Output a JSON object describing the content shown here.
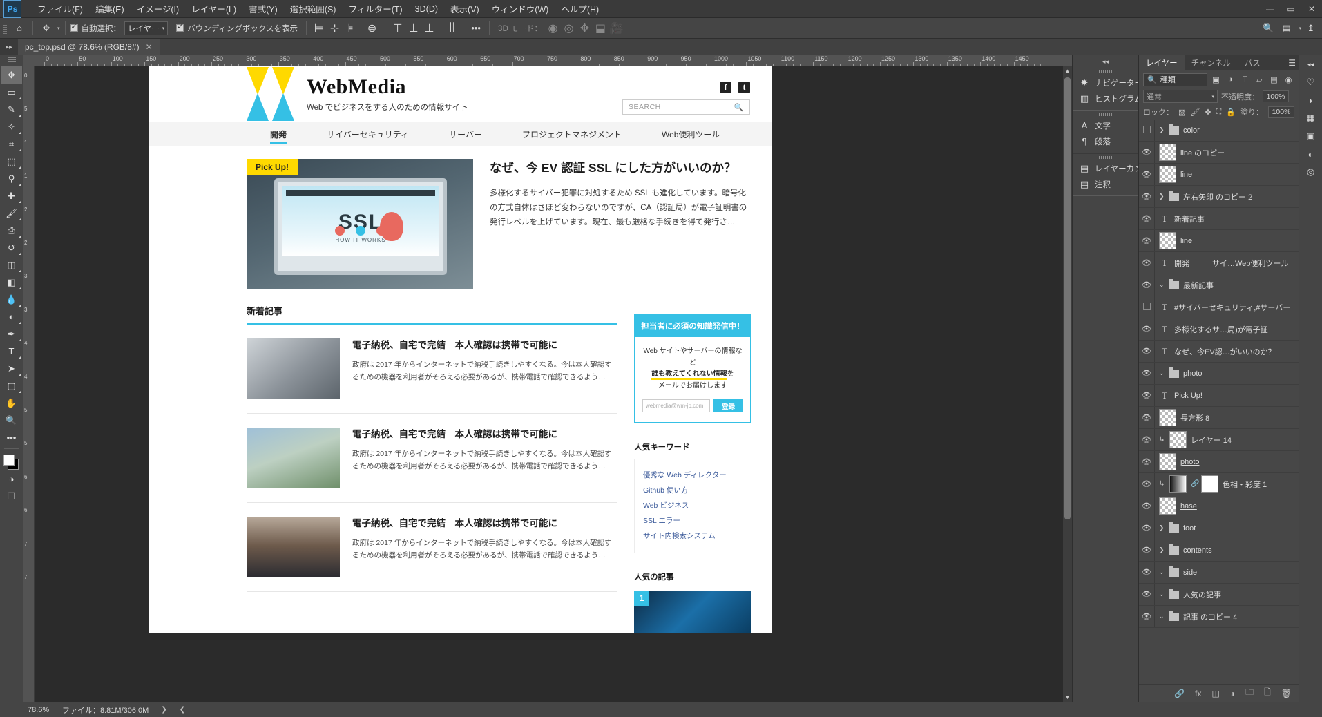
{
  "app": {
    "logo": "Ps",
    "menus": [
      {
        "label": "ファイル(F)"
      },
      {
        "label": "編集(E)"
      },
      {
        "label": "イメージ(I)"
      },
      {
        "label": "レイヤー(L)"
      },
      {
        "label": "書式(Y)"
      },
      {
        "label": "選択範囲(S)"
      },
      {
        "label": "フィルター(T)"
      },
      {
        "label": "3D(D)"
      },
      {
        "label": "表示(V)"
      },
      {
        "label": "ウィンドウ(W)"
      },
      {
        "label": "ヘルプ(H)"
      }
    ],
    "window_controls": {
      "minimize": "—",
      "maximize": "▭",
      "close": "✕"
    }
  },
  "options_bar": {
    "home_icon": "⌂",
    "move_tool_icon": "✥",
    "auto_select_label": "自動選択：",
    "auto_select_value": "レイヤー",
    "show_bounding_box_label": "バウンディングボックスを表示",
    "threed_mode_label": "3D モード：",
    "more_icon": "•••"
  },
  "document": {
    "tab_title": "pc_top.psd @ 78.6% (RGB/8#)",
    "close_icon": "✕"
  },
  "toolbox": {
    "tools": [
      {
        "name": "move-tool",
        "glyph": "✥"
      },
      {
        "name": "marquee-tool",
        "glyph": "▭"
      },
      {
        "name": "lasso-tool",
        "glyph": "✎"
      },
      {
        "name": "quick-select-tool",
        "glyph": "✧"
      },
      {
        "name": "crop-tool",
        "glyph": "⌗"
      },
      {
        "name": "frame-tool",
        "glyph": "⬚"
      },
      {
        "name": "eyedropper-tool",
        "glyph": "⚲"
      },
      {
        "name": "healing-brush-tool",
        "glyph": "✚"
      },
      {
        "name": "brush-tool",
        "glyph": "🖌"
      },
      {
        "name": "clone-stamp-tool",
        "glyph": "⎙"
      },
      {
        "name": "history-brush-tool",
        "glyph": "↺"
      },
      {
        "name": "eraser-tool",
        "glyph": "◫"
      },
      {
        "name": "gradient-tool",
        "glyph": "◧"
      },
      {
        "name": "blur-tool",
        "glyph": "💧"
      },
      {
        "name": "dodge-tool",
        "glyph": "◐"
      },
      {
        "name": "pen-tool",
        "glyph": "✒"
      },
      {
        "name": "type-tool",
        "glyph": "T"
      },
      {
        "name": "path-selection-tool",
        "glyph": "➤"
      },
      {
        "name": "shape-tool",
        "glyph": "▢"
      },
      {
        "name": "hand-tool",
        "glyph": "✋"
      },
      {
        "name": "zoom-tool",
        "glyph": "🔍"
      },
      {
        "name": "more-tools",
        "glyph": "•••"
      }
    ],
    "foreground_color": "#ffffff",
    "background_color": "#000000",
    "quickmask_glyph": "◑",
    "screenmode_glyph": "❐"
  },
  "rulers": {
    "horizontal_ticks": [
      "0",
      "50",
      "100",
      "150",
      "200",
      "250",
      "300",
      "350",
      "400",
      "450",
      "500",
      "550",
      "600",
      "650",
      "700",
      "750",
      "800",
      "850",
      "900",
      "950",
      "1000",
      "1050",
      "1100",
      "1150",
      "1200",
      "1250",
      "1300",
      "1350",
      "1400",
      "1450"
    ],
    "vertical_ticks": [
      "0",
      "5",
      "1",
      "1",
      "2",
      "2",
      "3",
      "3",
      "4",
      "4",
      "5",
      "5",
      "6",
      "6",
      "7",
      "7"
    ]
  },
  "webpage": {
    "brand_name": "WebMedia",
    "brand_tagline": "Web でビジネスをする人のための情報サイト",
    "search_placeholder": "SEARCH",
    "social": [
      {
        "name": "facebook-icon",
        "glyph": "f"
      },
      {
        "name": "twitter-icon",
        "glyph": "t"
      }
    ],
    "nav": [
      {
        "label": "開発",
        "active": true
      },
      {
        "label": "サイバーセキュリティ",
        "active": false
      },
      {
        "label": "サーバー",
        "active": false
      },
      {
        "label": "プロジェクトマネジメント",
        "active": false
      },
      {
        "label": "Web便利ツール",
        "active": false
      }
    ],
    "hero": {
      "badge": "Pick Up!",
      "image_text": "SSL",
      "image_subtext": "HOW IT WORKS",
      "title": "なぜ、今 EV 認証 SSL にした方がいいのか？",
      "excerpt": "多様化するサイバー犯罪に対処するため SSL も進化しています。暗号化の方式自体はさほど変わらないのですが、CA（認証局）が電子証明書の発行レベルを上げています。現在、最も厳格な手続きを得て発行さ…"
    },
    "section_title": "新着記事",
    "articles": [
      {
        "title": "電子納税、自宅で完結　本人確認は携帯で可能に",
        "excerpt": "政府は 2017 年からインターネットで納税手続きしやすくなる。今は本人確認するための機器を利用者がそろえる必要があるが、携帯電話で確認できるよう…"
      },
      {
        "title": "電子納税、自宅で完結　本人確認は携帯で可能に",
        "excerpt": "政府は 2017 年からインターネットで納税手続きしやすくなる。今は本人確認するための機器を利用者がそろえる必要があるが、携帯電話で確認できるよう…"
      },
      {
        "title": "電子納税、自宅で完結　本人確認は携帯で可能に",
        "excerpt": "政府は 2017 年からインターネットで納税手続きしやすくなる。今は本人確認するための機器を利用者がそろえる必要があるが、携帯電話で確認できるよう…"
      }
    ],
    "promo": {
      "heading": "担当者に必須の知識発信中！",
      "line1": "Web サイトやサーバーの情報など",
      "line2_highlight": "誰も教えてくれない情報",
      "line2_tail": "を",
      "line3": "メールでお届けします",
      "input_placeholder": "webmedia@wm-jp.com",
      "button": "登録"
    },
    "keywords_title": "人気キーワード",
    "keywords": [
      "優秀な Web ディレクター",
      "Github 使い方",
      "Web ビジネス",
      "SSL エラー",
      "サイト内検索システム"
    ],
    "popular_title": "人気の記事",
    "popular_rank": "1"
  },
  "icon_dock": [
    {
      "name": "navigator-panel",
      "glyph": "✸",
      "label": "ナビゲーター"
    },
    {
      "name": "histogram-panel",
      "glyph": "▥",
      "label": "ヒストグラム"
    },
    {
      "name": "character-panel",
      "glyph": "A",
      "label": "文字"
    },
    {
      "name": "paragraph-panel",
      "glyph": "¶",
      "label": "段落"
    },
    {
      "name": "layer-comps-panel",
      "glyph": "▤",
      "label": "レイヤーカンプ"
    },
    {
      "name": "notes-panel",
      "glyph": "▤",
      "label": "注釈"
    }
  ],
  "right_dock": [
    {
      "name": "learn-panel",
      "glyph": "♡",
      "label": "ラーニング"
    },
    {
      "name": "color-panel",
      "glyph": "◗",
      "label": "カラー"
    },
    {
      "name": "swatches-panel",
      "glyph": "▦",
      "label": "スウォッチ"
    },
    {
      "name": "properties-panel",
      "glyph": "▣",
      "label": "属性"
    },
    {
      "name": "adjustments-panel",
      "glyph": "◐",
      "label": "色調補正"
    },
    {
      "name": "cc-libraries-panel",
      "glyph": "◎",
      "label": "CC ライブラリ"
    }
  ],
  "layers_panel": {
    "tabs": [
      {
        "label": "レイヤー",
        "active": true
      },
      {
        "label": "チャンネル",
        "active": false
      },
      {
        "label": "パス",
        "active": false
      }
    ],
    "menu_icon": "☰",
    "filter": {
      "search_icon": "🔍",
      "kind_label": "種類",
      "type_icons": [
        "▣",
        "◑",
        "T",
        "▱",
        "▤"
      ],
      "toggle_icon": "◉"
    },
    "blend_mode": "通常",
    "opacity_label": "不透明度：",
    "opacity_value": "100%",
    "lock_label": "ロック：",
    "lock_icons": [
      "▨",
      "🖌",
      "✥",
      "⛶",
      "🔒"
    ],
    "fill_label": "塗り：",
    "fill_value": "100%",
    "rows": [
      {
        "name": "color",
        "visible": false,
        "kind": "group",
        "indent": 0,
        "expanded": false,
        "underline": false
      },
      {
        "name": "line のコピー",
        "visible": true,
        "kind": "pixel",
        "indent": 0,
        "expanded": null,
        "underline": false
      },
      {
        "name": "line",
        "visible": true,
        "kind": "pixel",
        "indent": 0,
        "expanded": null,
        "underline": false
      },
      {
        "name": "左右矢印 のコピー 2",
        "visible": true,
        "kind": "group",
        "indent": 0,
        "expanded": false,
        "underline": false
      },
      {
        "name": "新着記事",
        "visible": true,
        "kind": "text",
        "indent": 0,
        "expanded": null,
        "underline": false
      },
      {
        "name": "line",
        "visible": true,
        "kind": "pixel",
        "indent": 0,
        "expanded": null,
        "underline": false
      },
      {
        "name": "開発　　　サイ…Web便利ツール",
        "visible": true,
        "kind": "text",
        "indent": 0,
        "expanded": null,
        "underline": false
      },
      {
        "name": "最新記事",
        "visible": true,
        "kind": "group",
        "indent": 0,
        "expanded": true,
        "underline": false
      },
      {
        "name": "#サイバーセキュリティ,#サーバー",
        "visible": false,
        "kind": "text",
        "indent": 1,
        "expanded": null,
        "underline": false
      },
      {
        "name": "多様化するサ…局)が電子証",
        "visible": true,
        "kind": "text",
        "indent": 1,
        "expanded": null,
        "underline": false
      },
      {
        "name": "なぜ、今EV認…がいいのか？",
        "visible": true,
        "kind": "text",
        "indent": 1,
        "expanded": null,
        "underline": false
      },
      {
        "name": "photo",
        "visible": true,
        "kind": "group",
        "indent": 1,
        "expanded": true,
        "underline": false
      },
      {
        "name": "Pick Up!",
        "visible": true,
        "kind": "text",
        "indent": 2,
        "expanded": null,
        "underline": false
      },
      {
        "name": "長方形 8",
        "visible": true,
        "kind": "pixel",
        "indent": 2,
        "expanded": null,
        "underline": false
      },
      {
        "name": "レイヤー 14",
        "visible": true,
        "kind": "clipped",
        "indent": 2,
        "expanded": null,
        "underline": false
      },
      {
        "name": "photo",
        "visible": true,
        "kind": "pixel",
        "indent": 2,
        "expanded": null,
        "underline": true
      },
      {
        "name": "色相・彩度 1",
        "visible": true,
        "kind": "adjust",
        "indent": 1,
        "expanded": null,
        "underline": false
      },
      {
        "name": "hase",
        "visible": true,
        "kind": "pixel",
        "indent": 1,
        "expanded": null,
        "underline": true
      },
      {
        "name": "foot",
        "visible": true,
        "kind": "group",
        "indent": 0,
        "expanded": false,
        "underline": false
      },
      {
        "name": "contents",
        "visible": true,
        "kind": "group",
        "indent": 0,
        "expanded": false,
        "underline": false
      },
      {
        "name": "side",
        "visible": true,
        "kind": "group",
        "indent": 0,
        "expanded": true,
        "underline": false
      },
      {
        "name": "人気の記事",
        "visible": true,
        "kind": "group",
        "indent": 1,
        "expanded": true,
        "underline": false
      },
      {
        "name": "記事 のコピー 4",
        "visible": true,
        "kind": "group",
        "indent": 2,
        "expanded": true,
        "underline": false
      }
    ],
    "footer_icons": [
      {
        "name": "link-layers-icon",
        "glyph": "🔗"
      },
      {
        "name": "layer-style-icon",
        "glyph": "fx"
      },
      {
        "name": "layer-mask-icon",
        "glyph": "◫"
      },
      {
        "name": "adjustment-layer-icon",
        "glyph": "◑"
      },
      {
        "name": "new-group-icon",
        "glyph": "🗀"
      },
      {
        "name": "new-layer-icon",
        "glyph": "🗋"
      },
      {
        "name": "delete-layer-icon",
        "glyph": "🗑"
      }
    ]
  },
  "status_bar": {
    "zoom": "78.6%",
    "doc_info": "ファイル：8.81M/306.0M",
    "arrow_right": "❯",
    "arrow_left": "❮"
  }
}
